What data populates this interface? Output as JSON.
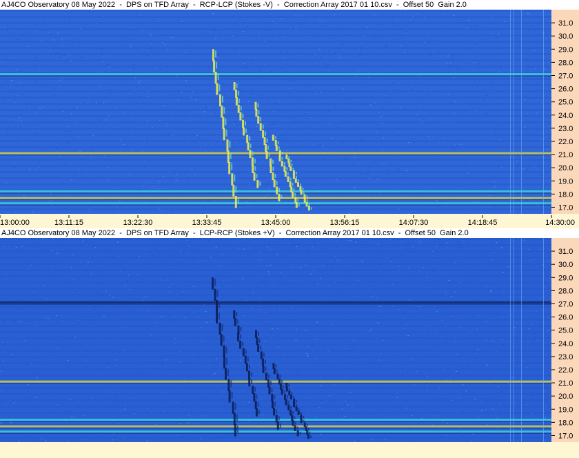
{
  "chart_data": [
    {
      "type": "heatmap",
      "title": "AJ4CO Observatory 08 May 2022  -  DPS on TFD Array  -  RCP-LCP (Stokes -V)  -  Correction Array 2017 01 10.csv  -  Offset 50  Gain 2.0",
      "xlabel": "",
      "ylabel": "",
      "x_ticks": [
        "13:00:00",
        "13:11:15",
        "13:22:30",
        "13:33:45",
        "13:45:00",
        "13:56:15",
        "14:07:30",
        "14:18:45",
        "14:30:00"
      ],
      "y_ticks": [
        17.0,
        18.0,
        19.0,
        20.0,
        21.0,
        22.0,
        23.0,
        24.0,
        25.0,
        26.0,
        27.0,
        28.0,
        29.0,
        30.0,
        31.0
      ],
      "ylim": [
        16.5,
        32.0
      ],
      "x_range": [
        "13:00:00",
        "14:30:00"
      ],
      "colormap": "blue-cyan-yellow",
      "background_color": "#2f66d8",
      "burst_polarity": "bright",
      "burst_events": [
        {
          "time": "13:34:30",
          "freq_start": 29.0,
          "freq_end": 17.0
        },
        {
          "time": "13:38:00",
          "freq_start": 26.5,
          "freq_end": 18.5
        },
        {
          "time": "13:41:30",
          "freq_start": 25.0,
          "freq_end": 17.5
        },
        {
          "time": "13:44:30",
          "freq_start": 22.5,
          "freq_end": 17.0
        },
        {
          "time": "13:46:30",
          "freq_start": 21.0,
          "freq_end": 16.8
        }
      ],
      "interference_bands_mhz": [
        27.1,
        21.1,
        18.2,
        17.7,
        17.3
      ]
    },
    {
      "type": "heatmap",
      "title": "AJ4CO Observatory 08 May 2022  -  DPS on TFD Array  -  LCP-RCP (Stokes +V)  -  Correction Array 2017 01 10.csv  -  Offset 50  Gain 2.0",
      "xlabel": "",
      "ylabel": "",
      "y_ticks": [
        17.0,
        18.0,
        19.0,
        20.0,
        21.0,
        22.0,
        23.0,
        24.0,
        25.0,
        26.0,
        27.0,
        28.0,
        29.0,
        30.0,
        31.0
      ],
      "ylim": [
        16.5,
        32.0
      ],
      "x_range": [
        "13:00:00",
        "14:30:00"
      ],
      "colormap": "blue-cyan-yellow",
      "background_color": "#2a5fd4",
      "burst_polarity": "dark",
      "burst_events": [
        {
          "time": "13:34:30",
          "freq_start": 29.0,
          "freq_end": 17.0
        },
        {
          "time": "13:38:00",
          "freq_start": 26.5,
          "freq_end": 18.5
        },
        {
          "time": "13:41:30",
          "freq_start": 25.0,
          "freq_end": 17.5
        },
        {
          "time": "13:44:30",
          "freq_start": 22.5,
          "freq_end": 17.0
        },
        {
          "time": "13:46:30",
          "freq_start": 21.0,
          "freq_end": 16.8
        }
      ],
      "interference_bands_mhz": [
        27.1,
        21.1,
        18.2,
        17.7,
        17.3
      ]
    }
  ],
  "colors": {
    "page_background": "#fff6d4",
    "axis_background": "#fcd8ba",
    "title_background": "#ffffff",
    "burst_bright": "#f0f050",
    "burst_dark": "#0a1a50",
    "band_bright": "#e8e040",
    "band_cyan": "#40e0e0"
  }
}
